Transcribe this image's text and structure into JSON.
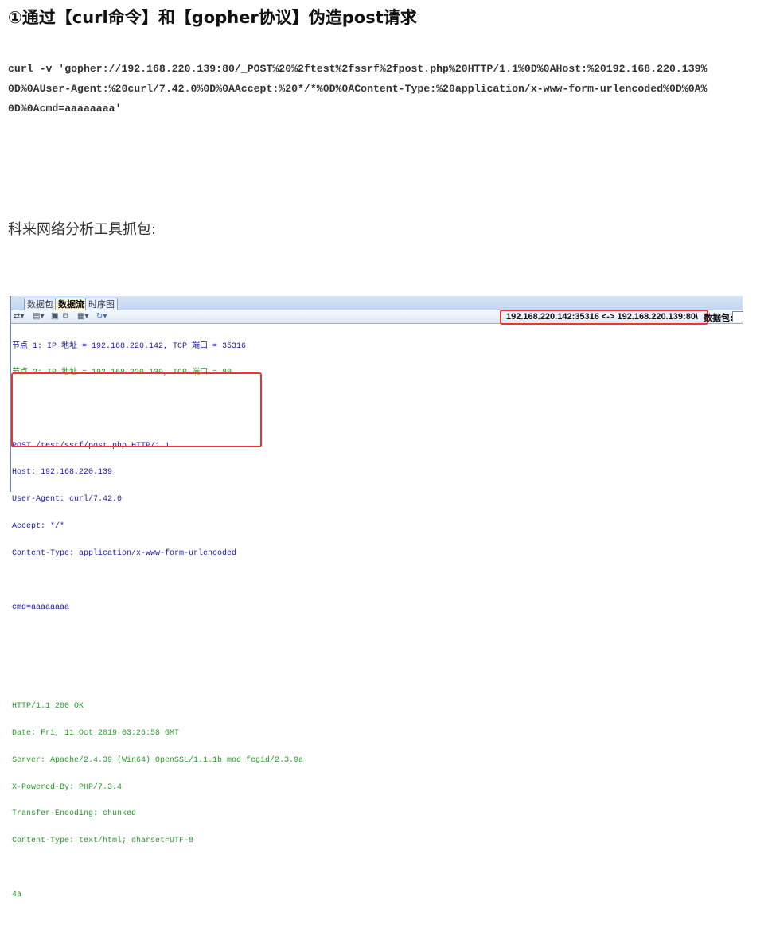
{
  "heading": "①通过【curl命令】和【gopher协议】伪造post请求",
  "code_lines": [
    "curl -v 'gopher://192.168.220.139:80/_POST%20%2ftest%2fssrf%2fpost.php%20HTTP/1.1%0D%0AHost:%20192.168.220.139%",
    "0D%0AUser-Agent:%20curl/7.42.0%0D%0AAccept:%20*/*%0D%0AContent-Type:%20application/x-www-form-urlencoded%0D%0A%",
    "0D%0Acmd=aaaaaaaa'"
  ],
  "paragraph": "科来网络分析工具抓包:",
  "screenshot": {
    "tabs": [
      "数据包",
      "数据流",
      "时序图"
    ],
    "active_tab": "数据流",
    "connection": "192.168.220.142:35316 <-> 192.168.220.139:80\\",
    "packets_label": "数据包:",
    "node_lines": [
      "节点 1: IP 地址 = 192.168.220.142, TCP 端口 = 35316",
      "节点 2: IP 地址 = 192.168.220.139, TCP 端口 = 80"
    ],
    "request_lines": [
      "POST /test/ssrf/post.php HTTP/1.1",
      "Host: 192.168.220.139",
      "User-Agent: curl/7.42.0",
      "Accept: */*",
      "Content-Type: application/x-www-form-urlencoded",
      "",
      "cmd=aaaaaaaa"
    ],
    "response_lines": [
      "HTTP/1.1 200 OK",
      "Date: Fri, 11 Oct 2019 03:26:58 GMT",
      "Server: Apache/2.4.39 (Win64) OpenSSL/1.1.1b mod_fcgid/2.3.9a",
      "X-Powered-By: PHP/7.3.4",
      "Transfer-Encoding: chunked",
      "Content-Type: text/html; charset=UTF-8",
      "",
      "4a"
    ]
  }
}
